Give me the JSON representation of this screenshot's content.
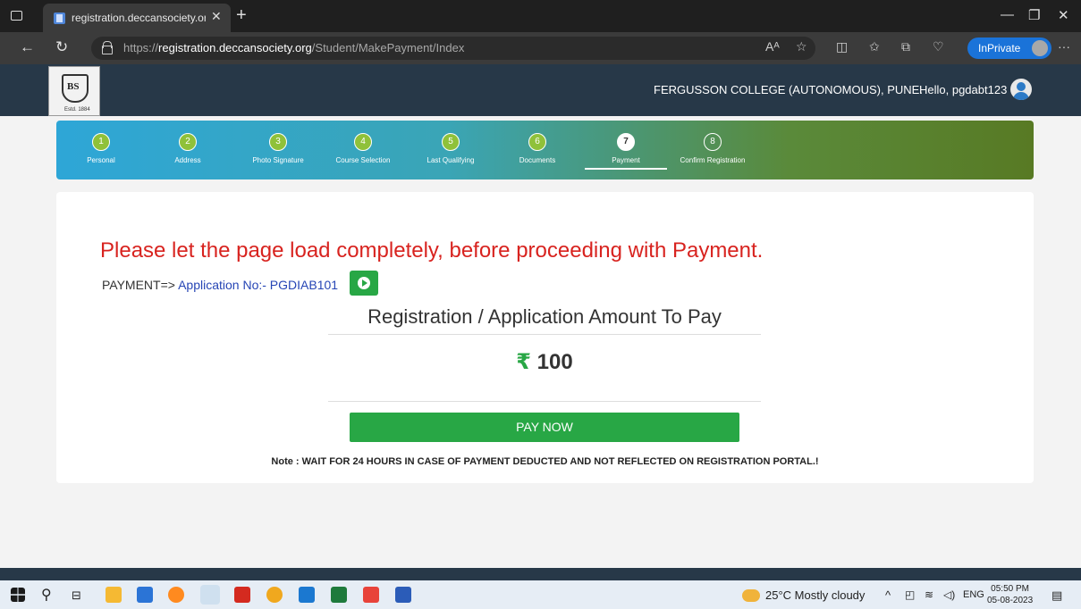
{
  "browser": {
    "tab_title": "registration.deccansociety.org/St",
    "url_prefix": "https://",
    "url_domain": "registration.deccansociety.org",
    "url_path": "/Student/MakePayment/Index",
    "inprivate_label": "InPrivate"
  },
  "header": {
    "college": "FERGUSSON COLLEGE (AUTONOMOUS), PUNE.",
    "greeting": "Hello, pgdabt123",
    "logo_est": "Estd. 1884"
  },
  "steps": [
    {
      "num": "1",
      "label": "Personal"
    },
    {
      "num": "2",
      "label": "Address"
    },
    {
      "num": "3",
      "label": "Photo Signature"
    },
    {
      "num": "4",
      "label": "Course Selection"
    },
    {
      "num": "5",
      "label": "Last Qualifying"
    },
    {
      "num": "6",
      "label": "Documents"
    },
    {
      "num": "7",
      "label": "Payment"
    },
    {
      "num": "8",
      "label": "Confirm Registration"
    }
  ],
  "content": {
    "warning": "Please let the page load completely, before proceeding with Payment.",
    "payment_prefix": "PAYMENT=>",
    "application_no": "Application No:- PGDIAB101",
    "amount_title": "Registration / Application Amount To Pay",
    "currency_symbol": "₹",
    "amount": "100",
    "pay_button": "PAY NOW",
    "note": "Note : WAIT FOR 24 HOURS IN CASE OF PAYMENT DEDUCTED AND NOT REFLECTED ON REGISTRATION PORTAL.!"
  },
  "taskbar": {
    "weather": "25°C  Mostly cloudy",
    "language": "ENG",
    "time": "05:50 PM",
    "date": "05-08-2023"
  }
}
